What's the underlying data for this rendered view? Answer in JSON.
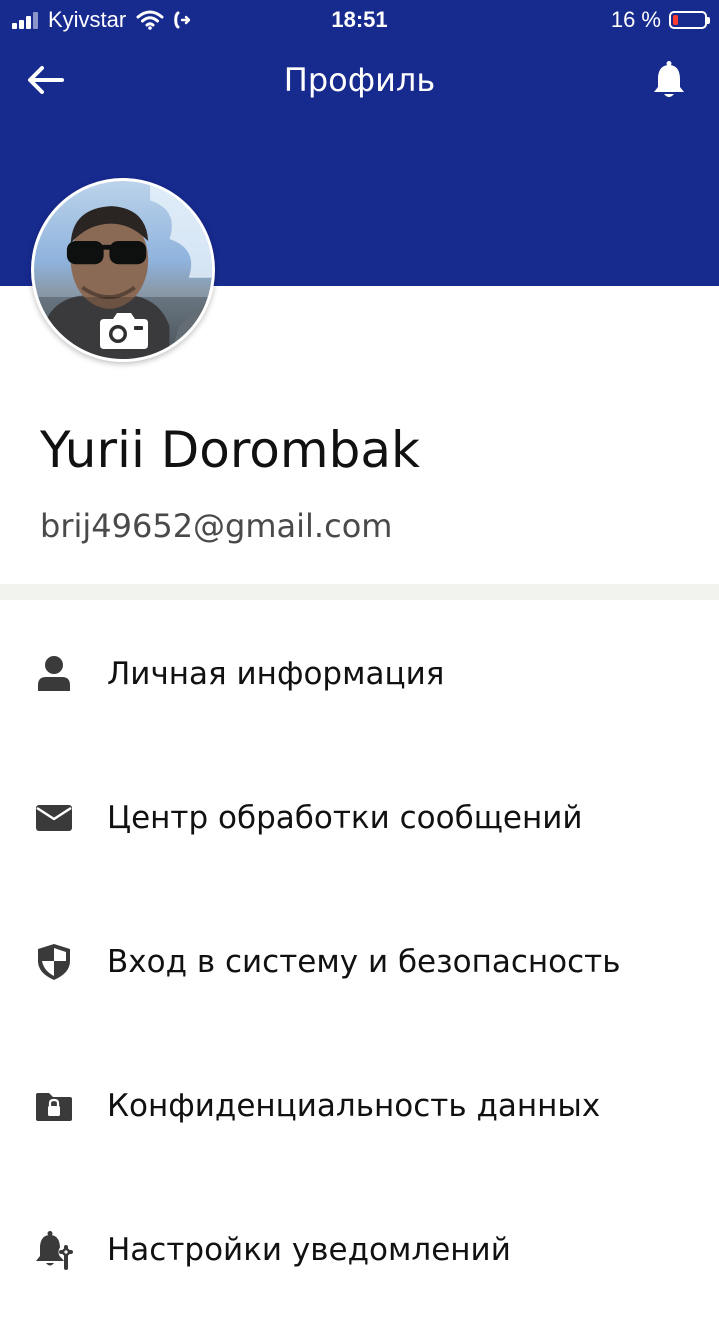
{
  "status_bar": {
    "carrier": "Kyivstar",
    "time": "18:51",
    "battery_percent_label": "16 %",
    "battery_level": 0.16,
    "battery_color": "#ff3b30",
    "icons": [
      "signal-icon",
      "wifi-icon",
      "call-forwarding-icon",
      "battery-icon"
    ]
  },
  "nav": {
    "title": "Профиль",
    "back_icon": "arrow-left-icon",
    "bell_icon": "bell-icon"
  },
  "profile": {
    "name": "Yurii Dorombak",
    "email": "brij49652@gmail.com",
    "avatar_icon": "camera-icon"
  },
  "menu": {
    "items": [
      {
        "label": "Личная информация",
        "icon": "person-icon"
      },
      {
        "label": "Центр обработки сообщений",
        "icon": "envelope-icon"
      },
      {
        "label": "Вход в систему и безопасность",
        "icon": "shield-icon"
      },
      {
        "label": "Конфиденциальность данных",
        "icon": "folder-lock-icon"
      },
      {
        "label": "Настройки уведомлений",
        "icon": "bell-wrench-icon"
      }
    ]
  },
  "colors": {
    "header": "#172a8e",
    "divider": "#f2f2ee",
    "icon": "#3a3a3a",
    "text": "#111111",
    "secondary_text": "#4a4a4a"
  }
}
